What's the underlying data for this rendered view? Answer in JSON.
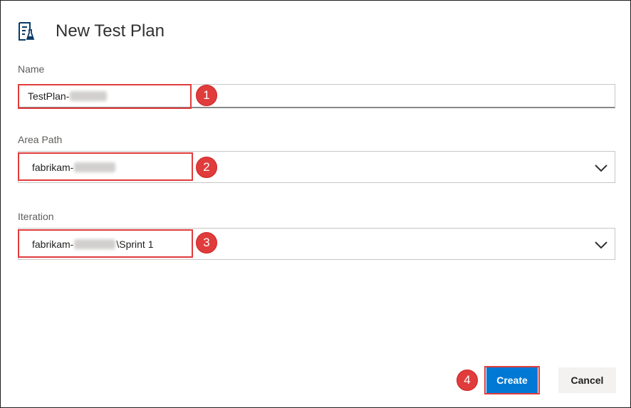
{
  "dialog": {
    "title": "New Test Plan",
    "title_icon": "test-plan-icon"
  },
  "fields": {
    "name": {
      "label": "Name",
      "value_prefix": "TestPlan-",
      "value_redacted": true
    },
    "area_path": {
      "label": "Area Path",
      "value_prefix": "fabrikam-",
      "value_redacted": true,
      "dropdown_icon": "chevron-down-icon"
    },
    "iteration": {
      "label": "Iteration",
      "value_prefix": "fabrikam-",
      "value_redacted": true,
      "value_suffix": "\\Sprint 1",
      "dropdown_icon": "chevron-down-icon"
    }
  },
  "callouts": [
    "1",
    "2",
    "3",
    "4"
  ],
  "buttons": {
    "create": "Create",
    "cancel": "Cancel"
  },
  "colors": {
    "primary": "#0078d4",
    "highlight": "#e03c3c",
    "secondary_button": "#f3f2f1"
  }
}
